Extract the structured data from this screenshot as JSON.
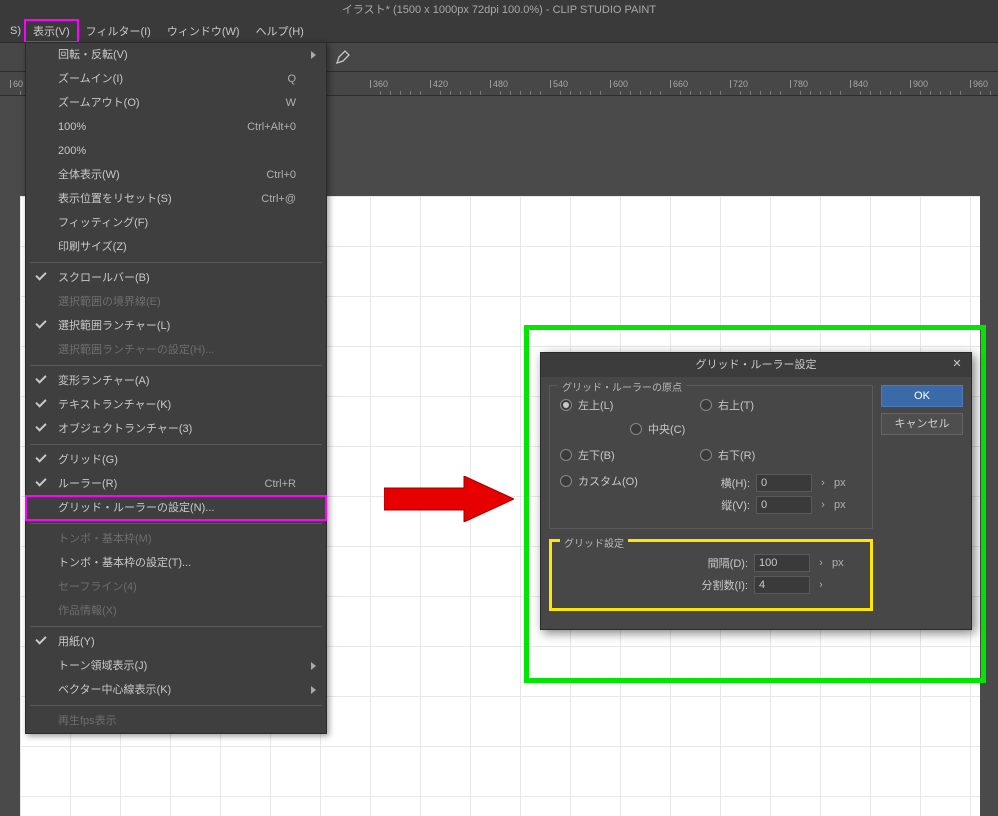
{
  "titlebar": "イラスト* (1500 x 1000px 72dpi 100.0%)   - CLIP STUDIO PAINT",
  "menubar": {
    "first": "S)",
    "items": [
      "表示(V)",
      "フィルター(I)",
      "ウィンドウ(W)",
      "ヘルプ(H)"
    ]
  },
  "ruler_ticks": [
    {
      "pos": 10,
      "label": "60"
    },
    {
      "pos": 370,
      "label": "360"
    },
    {
      "pos": 430,
      "label": "420"
    },
    {
      "pos": 490,
      "label": "480"
    },
    {
      "pos": 550,
      "label": "540"
    },
    {
      "pos": 610,
      "label": "600"
    },
    {
      "pos": 670,
      "label": "660"
    },
    {
      "pos": 730,
      "label": "720"
    },
    {
      "pos": 790,
      "label": "780"
    },
    {
      "pos": 850,
      "label": "840"
    },
    {
      "pos": 910,
      "label": "900"
    },
    {
      "pos": 970,
      "label": "960"
    }
  ],
  "menu_items": [
    {
      "label": "回転・反転(V)",
      "arrow": true
    },
    {
      "label": "ズームイン(I)",
      "shortcut": "Q"
    },
    {
      "label": "ズームアウト(O)",
      "shortcut": "W"
    },
    {
      "label": "100%",
      "shortcut": "Ctrl+Alt+0"
    },
    {
      "label": "200%"
    },
    {
      "label": "全体表示(W)",
      "shortcut": "Ctrl+0"
    },
    {
      "label": "表示位置をリセット(S)",
      "shortcut": "Ctrl+@"
    },
    {
      "label": "フィッティング(F)"
    },
    {
      "label": "印刷サイズ(Z)"
    },
    {
      "sep": true
    },
    {
      "label": "スクロールバー(B)",
      "check": true
    },
    {
      "label": "選択範囲の境界線(E)",
      "disabled": true
    },
    {
      "label": "選択範囲ランチャー(L)",
      "check": true
    },
    {
      "label": "選択範囲ランチャーの設定(H)...",
      "disabled": true
    },
    {
      "sep": true
    },
    {
      "label": "変形ランチャー(A)",
      "check": true
    },
    {
      "label": "テキストランチャー(K)",
      "check": true
    },
    {
      "label": "オブジェクトランチャー(3)",
      "check": true
    },
    {
      "sep": true
    },
    {
      "label": "グリッド(G)",
      "check": true
    },
    {
      "label": "ルーラー(R)",
      "shortcut": "Ctrl+R",
      "check": true
    },
    {
      "label": "グリッド・ルーラーの設定(N)...",
      "magenta": true
    },
    {
      "sep": true
    },
    {
      "label": "トンボ・基本枠(M)",
      "disabled": true
    },
    {
      "label": "トンボ・基本枠の設定(T)..."
    },
    {
      "label": "セーフライン(4)",
      "disabled": true
    },
    {
      "label": "作品情報(X)",
      "disabled": true
    },
    {
      "sep": true
    },
    {
      "label": "用紙(Y)",
      "check": true
    },
    {
      "label": "トーン領域表示(J)",
      "arrow": true
    },
    {
      "label": "ベクター中心線表示(K)",
      "arrow": true
    },
    {
      "sep": true
    },
    {
      "label": "再生fps表示",
      "disabled": true
    }
  ],
  "dialog": {
    "title": "グリッド・ルーラー設定",
    "origin_group": "グリッド・ルーラーの原点",
    "radios": {
      "lt": "左上(L)",
      "rt": "右上(T)",
      "c": "中央(C)",
      "lb": "左下(B)",
      "rb": "右下(R)",
      "custom": "カスタム(O)"
    },
    "h_label": "横(H):",
    "v_label": "縦(V):",
    "h_val": "0",
    "v_val": "0",
    "unit": "px",
    "grid_group": "グリッド設定",
    "spacing_label": "間隔(D):",
    "spacing_val": "100",
    "div_label": "分割数(I):",
    "div_val": "4",
    "ok": "OK",
    "cancel": "キャンセル"
  }
}
